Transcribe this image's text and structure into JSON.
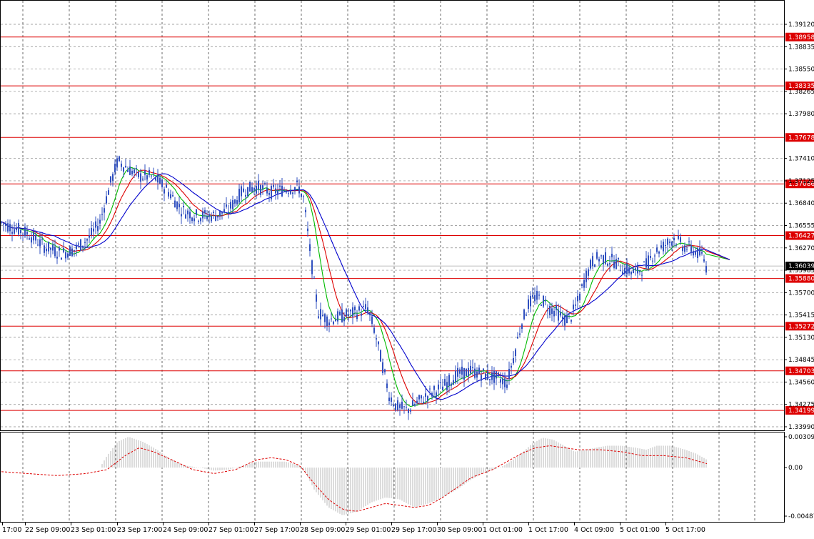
{
  "chart_data": {
    "type": "candlestick",
    "instrument_note": "",
    "price_axis": {
      "min": 1.399,
      "max": 1.3912,
      "ticks": [
        "1.39120",
        "1.38835",
        "1.38550",
        "1.38265",
        "1.37980",
        "1.37410",
        "1.37125",
        "1.36840",
        "1.36555",
        "1.36270",
        "1.35985",
        "1.35700",
        "1.35415",
        "1.35130",
        "1.34845",
        "1.34560",
        "1.34275",
        "1.33990"
      ],
      "current_price": "1.36039"
    },
    "levels": [
      {
        "value": "1.38958",
        "color": "#dd0000"
      },
      {
        "value": "1.38335",
        "color": "#dd0000"
      },
      {
        "value": "1.37678",
        "color": "#dd0000"
      },
      {
        "value": "1.37086",
        "color": "#dd0000"
      },
      {
        "value": "1.36427",
        "color": "#dd0000"
      },
      {
        "value": "1.35880",
        "color": "#dd0000"
      },
      {
        "value": "1.35272",
        "color": "#dd0000"
      },
      {
        "value": "1.34703",
        "color": "#dd0000"
      },
      {
        "value": "1.34199",
        "color": "#dd0000"
      }
    ],
    "time_labels": [
      "17:00",
      "22 Sep 09:00",
      "23 Sep 01:00",
      "23 Sep 17:00",
      "24 Sep 09:00",
      "27 Sep 01:00",
      "27 Sep 17:00",
      "28 Sep 09:00",
      "29 Sep 01:00",
      "29 Sep 17:00",
      "30 Sep 09:00",
      "1 Oct 01:00",
      "1 Oct 17:00",
      "4 Oct 09:00",
      "5 Oct 01:00",
      "5 Oct 17:00"
    ],
    "price_path_anchors": [
      [
        0,
        1.366
      ],
      [
        20,
        1.3652
      ],
      [
        40,
        1.3645
      ],
      [
        60,
        1.363
      ],
      [
        85,
        1.362
      ],
      [
        105,
        1.3625
      ],
      [
        125,
        1.364
      ],
      [
        140,
        1.366
      ],
      [
        155,
        1.371
      ],
      [
        165,
        1.3738
      ],
      [
        180,
        1.3728
      ],
      [
        195,
        1.3718
      ],
      [
        215,
        1.3718
      ],
      [
        235,
        1.37
      ],
      [
        255,
        1.3675
      ],
      [
        275,
        1.3668
      ],
      [
        300,
        1.3668
      ],
      [
        320,
        1.3675
      ],
      [
        340,
        1.37
      ],
      [
        360,
        1.3705
      ],
      [
        380,
        1.3698
      ],
      [
        400,
        1.3702
      ],
      [
        418,
        1.3705
      ],
      [
        425,
        1.369
      ],
      [
        432,
        1.364
      ],
      [
        440,
        1.358
      ],
      [
        446,
        1.3545
      ],
      [
        460,
        1.3535
      ],
      [
        480,
        1.354
      ],
      [
        500,
        1.3545
      ],
      [
        515,
        1.355
      ],
      [
        525,
        1.352
      ],
      [
        535,
        1.348
      ],
      [
        545,
        1.344
      ],
      [
        555,
        1.3425
      ],
      [
        570,
        1.342
      ],
      [
        585,
        1.343
      ],
      [
        600,
        1.344
      ],
      [
        620,
        1.345
      ],
      [
        640,
        1.3465
      ],
      [
        660,
        1.347
      ],
      [
        680,
        1.3465
      ],
      [
        700,
        1.346
      ],
      [
        710,
        1.3455
      ],
      [
        720,
        1.349
      ],
      [
        730,
        1.353
      ],
      [
        740,
        1.3555
      ],
      [
        750,
        1.3565
      ],
      [
        760,
        1.356
      ],
      [
        770,
        1.355
      ],
      [
        780,
        1.3545
      ],
      [
        790,
        1.3535
      ],
      [
        800,
        1.354
      ],
      [
        810,
        1.356
      ],
      [
        820,
        1.359
      ],
      [
        830,
        1.361
      ],
      [
        840,
        1.3615
      ],
      [
        860,
        1.361
      ],
      [
        875,
        1.36
      ],
      [
        890,
        1.3595
      ],
      [
        905,
        1.3605
      ],
      [
        915,
        1.362
      ],
      [
        930,
        1.363
      ],
      [
        945,
        1.364
      ],
      [
        955,
        1.363
      ],
      [
        970,
        1.3625
      ],
      [
        985,
        1.3615
      ],
      [
        990,
        1.36
      ]
    ],
    "macd": {
      "ticks": [
        "0.003099",
        "0.00",
        "-0.004874"
      ],
      "max": 0.003099,
      "min": -0.004874,
      "histogram_anchors": [
        [
          140,
          0.0
        ],
        [
          150,
          0.0012
        ],
        [
          165,
          0.0026
        ],
        [
          180,
          0.0031
        ],
        [
          200,
          0.0026
        ],
        [
          220,
          0.0018
        ],
        [
          240,
          0.0008
        ],
        [
          260,
          0.0002
        ],
        [
          280,
          0.0
        ],
        [
          300,
          -0.0003
        ],
        [
          320,
          -0.0002
        ],
        [
          340,
          0.0002
        ],
        [
          360,
          0.0006
        ],
        [
          400,
          0.0006
        ],
        [
          420,
          0.0002
        ],
        [
          430,
          -0.0008
        ],
        [
          440,
          -0.0022
        ],
        [
          460,
          -0.004
        ],
        [
          480,
          -0.0048
        ],
        [
          500,
          -0.0044
        ],
        [
          520,
          -0.0035
        ],
        [
          540,
          -0.003
        ],
        [
          560,
          -0.0032
        ],
        [
          580,
          -0.004
        ],
        [
          600,
          -0.0036
        ],
        [
          620,
          -0.003
        ],
        [
          640,
          -0.0022
        ],
        [
          660,
          -0.0012
        ],
        [
          680,
          -0.0004
        ],
        [
          700,
          0.0
        ],
        [
          715,
          0.0006
        ],
        [
          730,
          0.0014
        ],
        [
          745,
          0.0024
        ],
        [
          760,
          0.003
        ],
        [
          775,
          0.0028
        ],
        [
          790,
          0.0022
        ],
        [
          805,
          0.0016
        ],
        [
          820,
          0.0018
        ],
        [
          835,
          0.002
        ],
        [
          850,
          0.0022
        ],
        [
          870,
          0.0022
        ],
        [
          890,
          0.002
        ],
        [
          905,
          0.0018
        ],
        [
          920,
          0.0022
        ],
        [
          940,
          0.0022
        ],
        [
          960,
          0.0018
        ],
        [
          975,
          0.0014
        ],
        [
          990,
          0.0008
        ]
      ],
      "signal_anchors": [
        [
          0,
          -0.0004
        ],
        [
          40,
          -0.0006
        ],
        [
          80,
          -0.0008
        ],
        [
          120,
          -0.0006
        ],
        [
          150,
          -0.0002
        ],
        [
          175,
          0.0012
        ],
        [
          195,
          0.002
        ],
        [
          215,
          0.0016
        ],
        [
          240,
          0.0008
        ],
        [
          270,
          -0.0002
        ],
        [
          300,
          -0.0006
        ],
        [
          330,
          -0.0002
        ],
        [
          360,
          0.0008
        ],
        [
          380,
          0.001
        ],
        [
          400,
          0.0008
        ],
        [
          420,
          0.0002
        ],
        [
          440,
          -0.0016
        ],
        [
          460,
          -0.0032
        ],
        [
          480,
          -0.0042
        ],
        [
          500,
          -0.0044
        ],
        [
          520,
          -0.004
        ],
        [
          540,
          -0.0036
        ],
        [
          560,
          -0.0038
        ],
        [
          580,
          -0.004
        ],
        [
          600,
          -0.0038
        ],
        [
          620,
          -0.003
        ],
        [
          640,
          -0.002
        ],
        [
          660,
          -0.001
        ],
        [
          690,
          -0.0002
        ],
        [
          710,
          0.0006
        ],
        [
          730,
          0.0014
        ],
        [
          750,
          0.002
        ],
        [
          770,
          0.0022
        ],
        [
          790,
          0.002
        ],
        [
          810,
          0.0018
        ],
        [
          840,
          0.0018
        ],
        [
          870,
          0.0016
        ],
        [
          900,
          0.0012
        ],
        [
          930,
          0.0012
        ],
        [
          960,
          0.001
        ],
        [
          990,
          0.0004
        ]
      ]
    },
    "ma_colors": {
      "fast": "#00bb00",
      "mid": "#dd0000",
      "slow": "#0000cc"
    },
    "candle_color": "#2f4fbf",
    "grid": true
  }
}
